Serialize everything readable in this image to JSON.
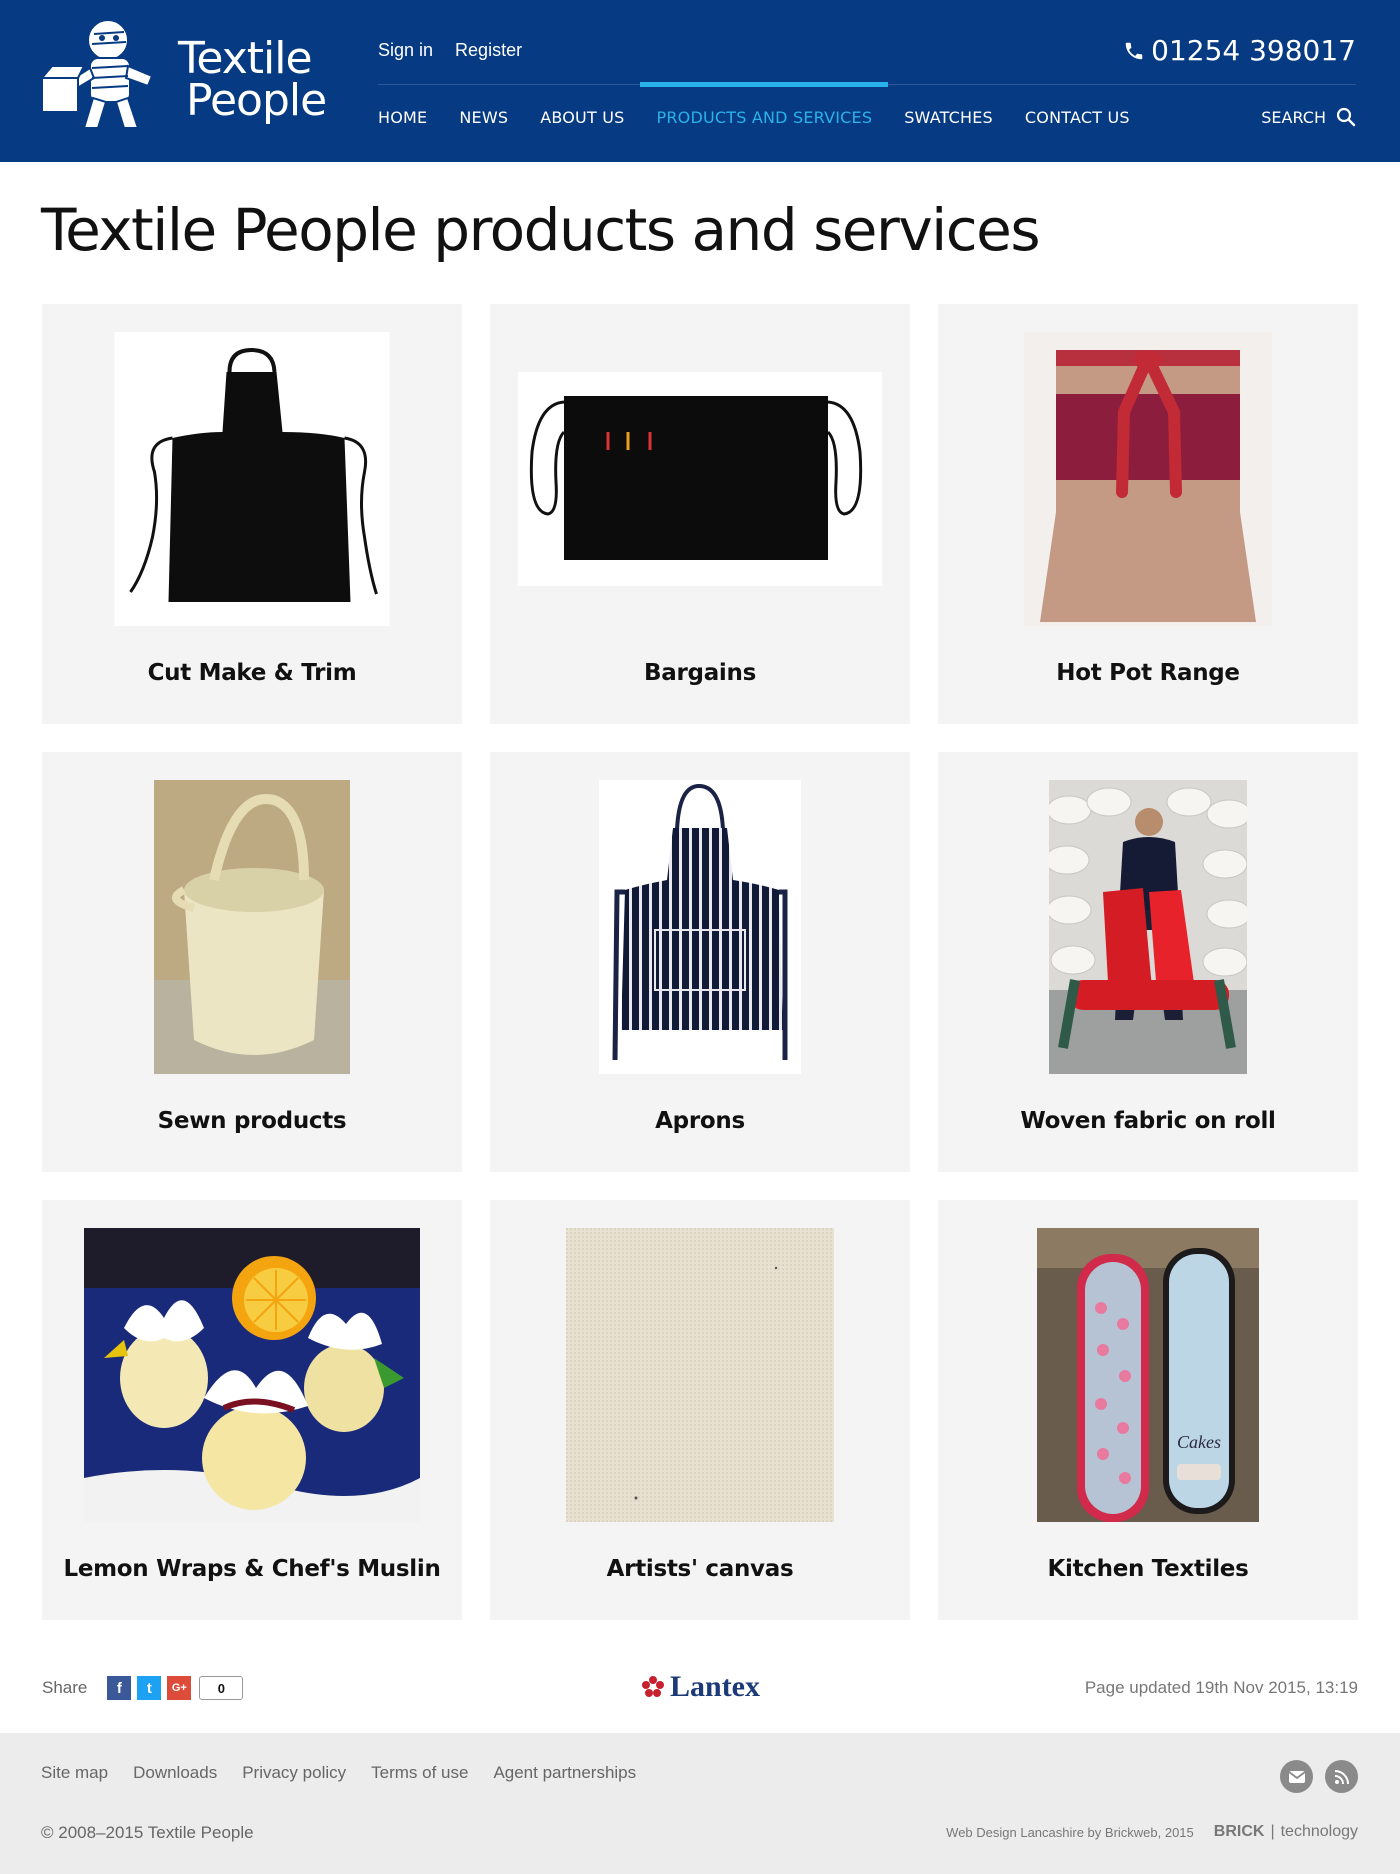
{
  "header": {
    "logo_line1": "Textile",
    "logo_line2": "People",
    "user_links": {
      "sign_in": "Sign in",
      "register": "Register"
    },
    "phone": "01254 398017",
    "nav": [
      {
        "label": "HOME",
        "active": false
      },
      {
        "label": "NEWS",
        "active": false
      },
      {
        "label": "ABOUT US",
        "active": false
      },
      {
        "label": "PRODUCTS AND SERVICES",
        "active": true
      },
      {
        "label": "SWATCHES",
        "active": false
      },
      {
        "label": "CONTACT US",
        "active": false
      }
    ],
    "search_label": "SEARCH",
    "colors": {
      "background": "#063a82",
      "active": "#2ab2ea"
    }
  },
  "main": {
    "title": "Textile People products and services",
    "products": [
      {
        "label": "Cut Make & Trim",
        "image": "black-bib-apron"
      },
      {
        "label": "Bargains",
        "image": "black-waist-apron"
      },
      {
        "label": "Hot Pot Range",
        "image": "tan-red-waist-apron"
      },
      {
        "label": "Sewn products",
        "image": "canvas-bucket-bag"
      },
      {
        "label": "Aprons",
        "image": "striped-bib-apron"
      },
      {
        "label": "Woven fabric on roll",
        "image": "man-with-red-fabric-roll"
      },
      {
        "label": "Lemon Wraps & Chef's Muslin",
        "image": "lemon-wraps"
      },
      {
        "label": "Artists' canvas",
        "image": "canvas-texture"
      },
      {
        "label": "Kitchen Textiles",
        "image": "oven-gloves"
      }
    ]
  },
  "share": {
    "label": "Share",
    "facebook": "f",
    "twitter": "t",
    "googleplus": "G+",
    "count": "0",
    "brand": "Lantex",
    "updated": "Page updated 19th Nov 2015, 13:19"
  },
  "footer": {
    "links": [
      "Site map",
      "Downloads",
      "Privacy policy",
      "Terms of use",
      "Agent partnerships"
    ],
    "copyright": "© 2008–2015  Textile People",
    "credit": "Web Design Lancashire by Brickweb, 2015",
    "brick": "BRICK",
    "technology": "technology",
    "icons": [
      "email-icon",
      "rss-icon"
    ]
  }
}
